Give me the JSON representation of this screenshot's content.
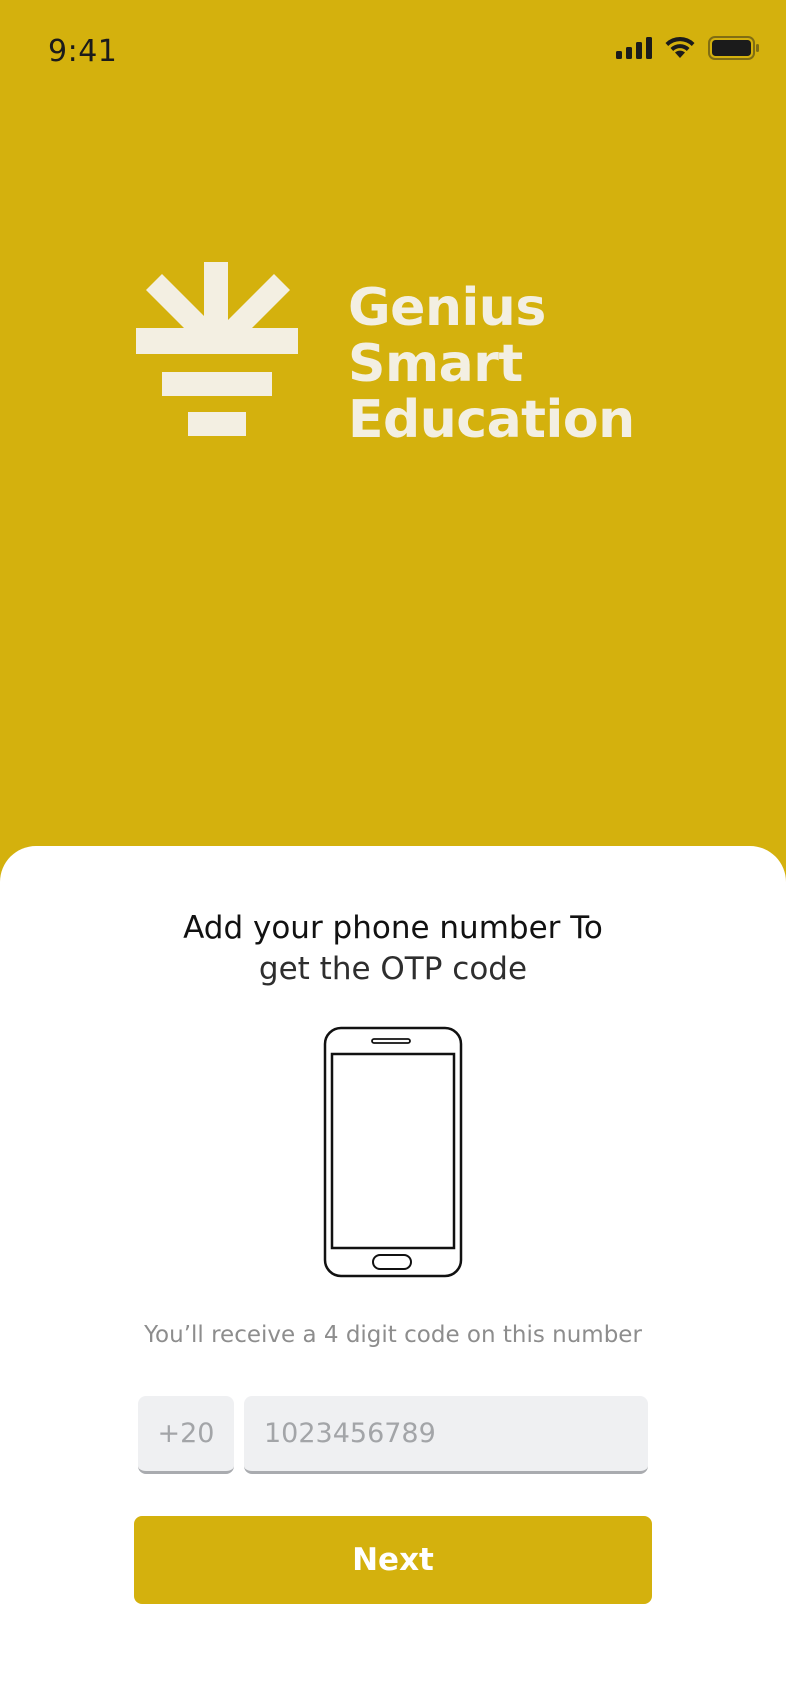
{
  "status_bar": {
    "time": "9:41",
    "icons": [
      "cellular-signal-icon",
      "wifi-icon",
      "battery-icon"
    ]
  },
  "logo": {
    "icon": "sunrise-logo-icon",
    "line1": "Genius",
    "line2": "Smart",
    "line3": "Education"
  },
  "sheet": {
    "title_line1": "Add your phone number To",
    "title_line2": "get the OTP code",
    "illustration": "smartphone-icon",
    "subtitle": "You’ll receive a 4 digit code on this number",
    "country_code": "+20",
    "phone_placeholder": "1023456789",
    "next_label": "Next"
  },
  "colors": {
    "brand": "#d4b10d",
    "logo": "#f3efe2",
    "sheet": "#ffffff",
    "input_bg": "#eff0f2",
    "muted_text": "#8d8d8d"
  }
}
